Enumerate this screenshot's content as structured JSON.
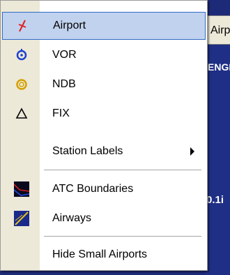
{
  "background": {
    "tab_label": "Airp",
    "line1": "ENGI",
    "line2": "0.1i"
  },
  "menu": {
    "items": [
      {
        "label": "Airport",
        "icon": "airport-icon",
        "selected": true
      },
      {
        "label": "VOR",
        "icon": "vor-icon"
      },
      {
        "label": "NDB",
        "icon": "ndb-icon"
      },
      {
        "label": "FIX",
        "icon": "fix-icon"
      },
      {
        "label": "Station Labels",
        "submenu": true
      },
      {
        "label": "ATC Boundaries",
        "icon": "atc-boundaries-icon"
      },
      {
        "label": "Airways",
        "icon": "airways-icon"
      },
      {
        "label": "Hide Small Airports"
      }
    ]
  },
  "colors": {
    "highlight_bg": "#c1d2ee",
    "highlight_border": "#316ac5",
    "airport_icon": "#e02020",
    "vor_icon": "#2040d0",
    "ndb_icon": "#d4a000",
    "background": "#1c2a78"
  }
}
